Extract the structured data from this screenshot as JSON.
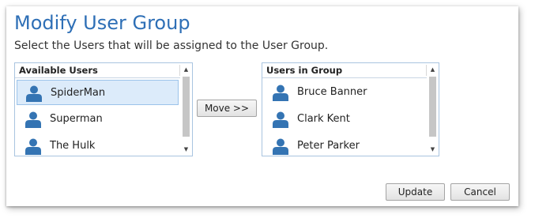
{
  "dialog": {
    "title": "Modify User Group",
    "subtitle": "Select the Users that will be assigned to the User Group."
  },
  "available_users": {
    "header": "Available Users",
    "items": [
      {
        "label": "SpiderMan",
        "selected": true
      },
      {
        "label": "Superman",
        "selected": false
      },
      {
        "label": "The Hulk",
        "selected": false
      }
    ]
  },
  "users_in_group": {
    "header": "Users in Group",
    "items": [
      {
        "label": "Bruce Banner"
      },
      {
        "label": "Clark Kent"
      },
      {
        "label": "Peter Parker"
      }
    ]
  },
  "buttons": {
    "move": "Move >>",
    "update": "Update",
    "cancel": "Cancel"
  },
  "scroll": {
    "up_glyph": "▲",
    "down_glyph": "▼"
  },
  "colors": {
    "title": "#2e6fb6",
    "user_icon": "#3474b3",
    "selected_row": "#dcebfa"
  }
}
